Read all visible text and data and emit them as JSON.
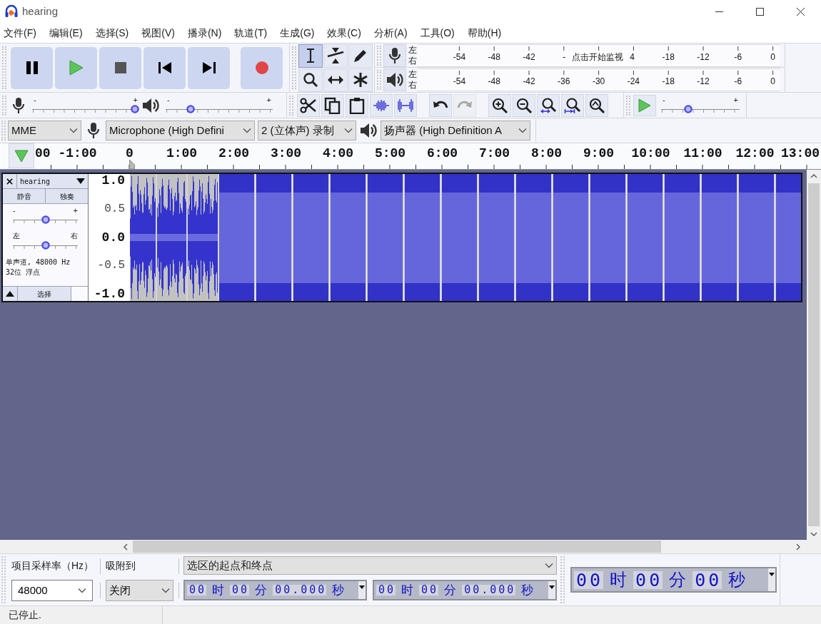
{
  "window": {
    "title": "hearing"
  },
  "menu": [
    "文件(F)",
    "编辑(E)",
    "选择(S)",
    "视图(V)",
    "播录(N)",
    "轨道(T)",
    "生成(G)",
    "效果(C)",
    "分析(A)",
    "工具(O)",
    "帮助(H)"
  ],
  "tools": [
    {
      "kind": "select",
      "selected": true
    },
    {
      "kind": "envelope",
      "selected": false
    },
    {
      "kind": "draw",
      "selected": false
    },
    {
      "kind": "zoom",
      "selected": false
    },
    {
      "kind": "timeshift",
      "selected": false
    },
    {
      "kind": "multi",
      "selected": false
    }
  ],
  "meters": [
    {
      "kind": "record",
      "channels": [
        "左",
        "右"
      ],
      "scale": [
        {
          "kind": "tick",
          "text": "-54"
        },
        {
          "kind": "tick",
          "text": "-48"
        },
        {
          "kind": "tick",
          "text": "-42"
        },
        {
          "kind": "cut",
          "text": "-"
        },
        {
          "kind": "prompt",
          "text": "点击开始监视"
        },
        {
          "kind": "cut",
          "text": "4"
        },
        {
          "kind": "tick",
          "text": "-18"
        },
        {
          "kind": "tick",
          "text": "-12"
        },
        {
          "kind": "tick",
          "text": "-6"
        },
        {
          "kind": "tick",
          "text": "0"
        }
      ]
    },
    {
      "kind": "playback",
      "channels": [
        "左",
        "右"
      ],
      "scale": [
        {
          "kind": "tick",
          "text": "-54"
        },
        {
          "kind": "tick",
          "text": "-48"
        },
        {
          "kind": "tick",
          "text": "-42"
        },
        {
          "kind": "tick",
          "text": "-36"
        },
        {
          "kind": "tick",
          "text": "-30"
        },
        {
          "kind": "tick",
          "text": "-24"
        },
        {
          "kind": "tick",
          "text": "-18"
        },
        {
          "kind": "tick",
          "text": "-12"
        },
        {
          "kind": "tick",
          "text": "-6"
        },
        {
          "kind": "tick",
          "text": "0"
        }
      ]
    }
  ],
  "mixer": {
    "record": {
      "min": "-",
      "max": "+",
      "level": 1
    },
    "playback": {
      "min": "-",
      "max": "+",
      "level": 0.21
    }
  },
  "edit_buttons": [
    {
      "kind": "cut",
      "disabled": false
    },
    {
      "kind": "copy",
      "disabled": false
    },
    {
      "kind": "paste",
      "disabled": false
    },
    {
      "kind": "trim",
      "disabled": false
    },
    {
      "kind": "silence",
      "disabled": false
    },
    {
      "kind": "undo",
      "disabled": false
    },
    {
      "kind": "redo",
      "disabled": true
    },
    {
      "kind": "zoom_in",
      "disabled": false
    },
    {
      "kind": "zoom_out",
      "disabled": false
    },
    {
      "kind": "fit_selection",
      "disabled": false
    },
    {
      "kind": "fit_project",
      "disabled": false
    },
    {
      "kind": "zoom_toggle",
      "disabled": false
    }
  ],
  "play_at_speed": {
    "min": "-",
    "max": "+",
    "level": 0.33
  },
  "devices": {
    "host": "MME",
    "input": "Microphone (High Defini",
    "channels": "2 (立体声) 录制",
    "output": "扬声器 (High Definition A"
  },
  "timeline": [
    "00",
    "-1:00",
    "0",
    "1:00",
    "2:00",
    "3:00",
    "4:00",
    "5:00",
    "6:00",
    "7:00",
    "8:00",
    "9:00",
    "10:00",
    "11:00",
    "12:00",
    "13:00"
  ],
  "track": {
    "name": "hearing",
    "mute": "静音",
    "solo": "独奏",
    "gain": {
      "min": "-",
      "max": "+",
      "level": 0.5
    },
    "pan": {
      "left": "左",
      "right": "右",
      "level": 0.5
    },
    "info": [
      "单声道, 48000 Hz",
      "32位 浮点"
    ],
    "select": "选择",
    "ruler": [
      {
        "text": "1.0",
        "kind": "major"
      },
      {
        "text": "0.5",
        "kind": "minor"
      },
      {
        "text": "0.0",
        "kind": "major"
      },
      {
        "text": "-0.5",
        "kind": "minor"
      },
      {
        "text": "-1.0",
        "kind": "major"
      }
    ]
  },
  "selection": {
    "rate_label": "项目采样率（Hz）",
    "snap_label": "吸附到",
    "rate": "48000",
    "snap": "关闭",
    "format": "选区的起点和终点",
    "start": [
      {
        "kind": "digits",
        "text": "00"
      },
      {
        "kind": "unit",
        "text": "时"
      },
      {
        "kind": "digits",
        "text": "00"
      },
      {
        "kind": "unit",
        "text": "分"
      },
      {
        "kind": "digits",
        "text": "00.000"
      },
      {
        "kind": "unit",
        "text": "秒"
      }
    ],
    "end": [
      {
        "kind": "digits",
        "text": "00"
      },
      {
        "kind": "unit",
        "text": "时"
      },
      {
        "kind": "digits",
        "text": "00"
      },
      {
        "kind": "unit",
        "text": "分"
      },
      {
        "kind": "digits",
        "text": "00.000"
      },
      {
        "kind": "unit",
        "text": "秒"
      }
    ]
  },
  "audio_position": [
    {
      "kind": "digits",
      "text": "00"
    },
    {
      "kind": "unit",
      "text": "时"
    },
    {
      "kind": "digits",
      "text": "00"
    },
    {
      "kind": "unit",
      "text": "分"
    },
    {
      "kind": "digits",
      "text": "00"
    },
    {
      "kind": "unit",
      "text": "秒"
    }
  ],
  "status": "已停止."
}
